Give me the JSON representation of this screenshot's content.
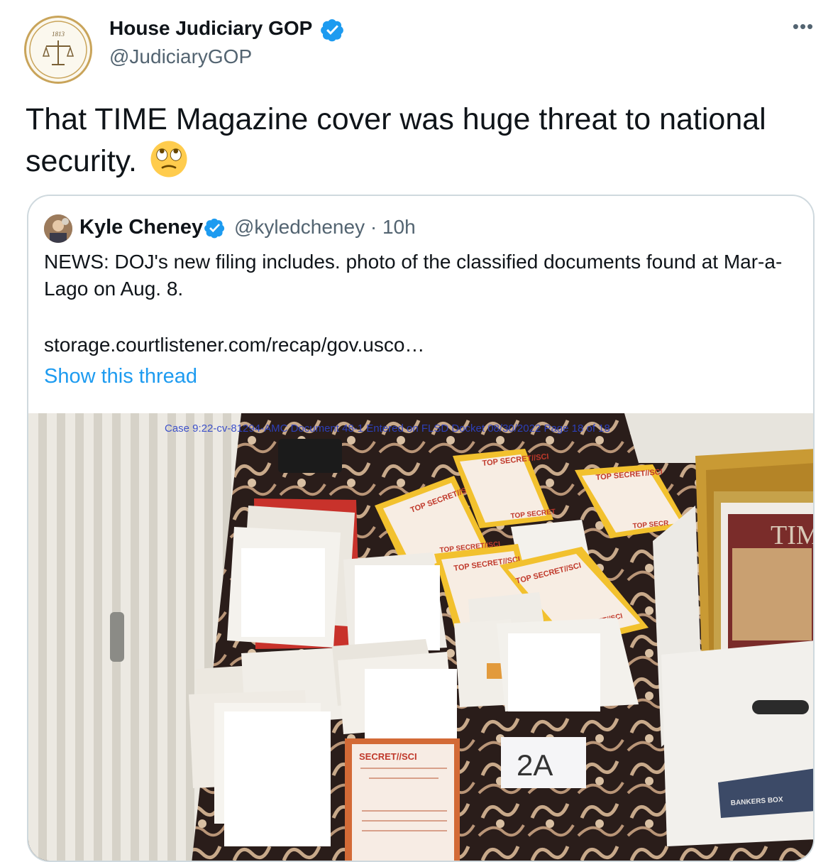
{
  "author": {
    "name": "House Judiciary GOP",
    "handle": "@JudiciaryGOP",
    "verified": true,
    "avatar_text": "1813"
  },
  "more_label": "•••",
  "tweet": {
    "text": "That TIME Magazine cover was huge threat to national security.",
    "emoji": "face-with-rolling-eyes"
  },
  "quoted": {
    "name": "Kyle Cheney",
    "meta": "@kyledcheney · 10h",
    "verified": true,
    "text": "NEWS: DOJ's new filing includes. photo of the classified documents found at Mar-a-Lago on Aug. 8.",
    "link": "storage.courtlistener.com/recap/gov.usco…",
    "show_thread": "Show this thread",
    "image": {
      "case_line": "Case 9:22-cv-81294-AMC   Document 48-1   Entered on FLSD Docket 08/30/2022   Page 18 of 18",
      "labels": {
        "ts1": "TOP SECRET//SCI",
        "ts2": "TOP SECRET//SCI",
        "ts3": "TOP SECRET//SCI",
        "ts4": "TOP SECRET",
        "ts5": "TOP SECRET//SCI",
        "ts6": "TOP SECRET//SCI",
        "ts7": "TOP SECR",
        "ts8": "CRET//SCI",
        "secret": "SECRET//SCI",
        "tag": "2A",
        "box": "BANKERS BOX",
        "time": "TIME"
      }
    }
  },
  "colors": {
    "text": "#0f1419",
    "secondary": "#536471",
    "accent": "#1d9bf0",
    "border": "#cfd9de"
  }
}
